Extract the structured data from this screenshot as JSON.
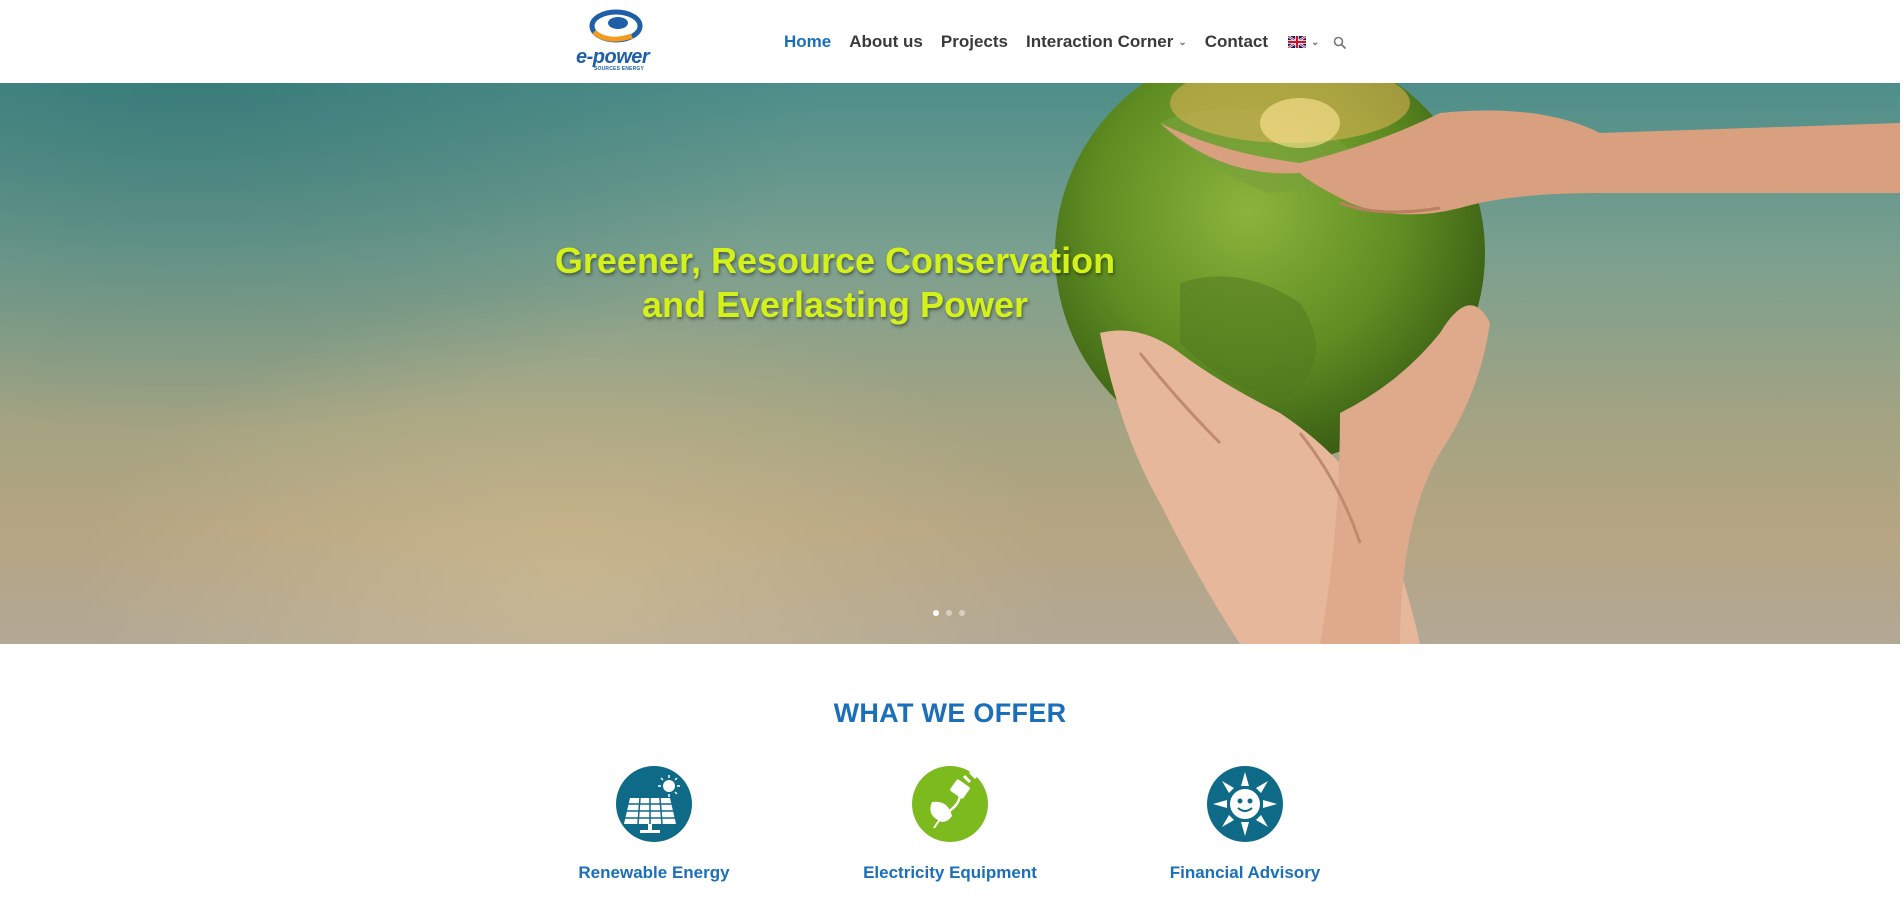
{
  "header": {
    "logo": {
      "text": "e-power",
      "subtext": "SOURCES ENERGY"
    },
    "nav": [
      {
        "label": "Home",
        "active": true,
        "has_dropdown": false
      },
      {
        "label": "About us",
        "active": false,
        "has_dropdown": false
      },
      {
        "label": "Projects",
        "active": false,
        "has_dropdown": false
      },
      {
        "label": "Interaction Corner",
        "active": false,
        "has_dropdown": true
      },
      {
        "label": "Contact",
        "active": false,
        "has_dropdown": false
      }
    ],
    "language": {
      "icon": "uk-flag-icon"
    },
    "search": {
      "icon": "search-icon"
    }
  },
  "hero": {
    "title_line1": "Greener, Resource Conservation",
    "title_line2": "and Everlasting Power",
    "slide_count": 3,
    "active_slide": 1
  },
  "offer": {
    "title": "WHAT WE OFFER",
    "services": [
      {
        "label": "Renewable Energy",
        "icon": "solar-panel-icon",
        "color": "#0f6a88"
      },
      {
        "label": "Electricity Equipment",
        "icon": "plug-leaf-icon",
        "color": "#7cba1e"
      },
      {
        "label": "Financial Advisory",
        "icon": "sun-face-icon",
        "color": "#0f6a88"
      }
    ]
  },
  "colors": {
    "accent": "#1a6fb8",
    "hero_title": "#d4f21a",
    "nav_text": "#3a3a3a"
  }
}
